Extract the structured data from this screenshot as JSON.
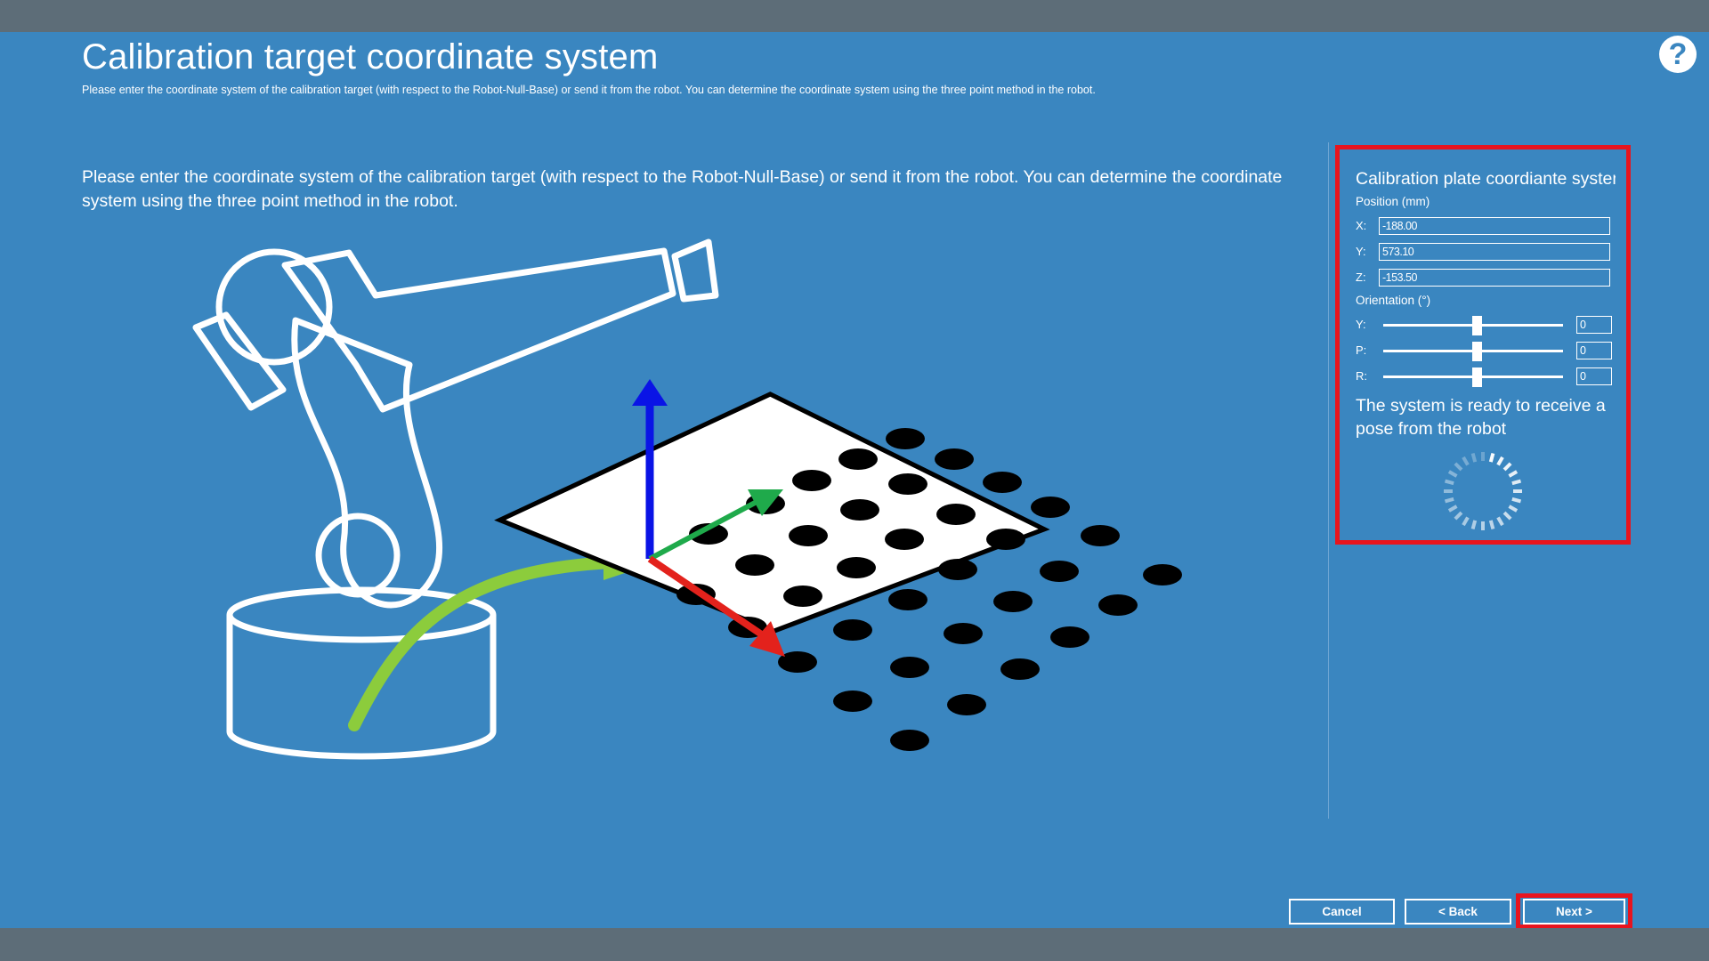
{
  "header": {
    "title": "Calibration target coordinate system",
    "subtitle": "Please enter the coordinate system of the calibration target (with respect to the Robot-Null-Base) or send it from the robot. You can determine the coordinate system using the three point method in the robot.",
    "help_glyph": "?"
  },
  "main": {
    "instructions": "Please enter the coordinate system of the calibration target (with respect to the Robot-Null-Base) or send it from the robot. You can determine the coordinate system using the three point method in the robot."
  },
  "panel": {
    "title": "Calibration plate coordiante system",
    "position_label": "Position (mm)",
    "position": [
      {
        "label": "X:",
        "value": "-188.00"
      },
      {
        "label": "Y:",
        "value": "573.10"
      },
      {
        "label": "Z:",
        "value": "-153.50"
      }
    ],
    "orientation_label": "Orientation (°)",
    "orientation": [
      {
        "label": "Y:",
        "value": "0",
        "slider_fraction": 0.5
      },
      {
        "label": "P:",
        "value": "0",
        "slider_fraction": 0.5
      },
      {
        "label": "R:",
        "value": "0",
        "slider_fraction": 0.5
      }
    ],
    "status": "The system is ready to receive a pose from the robot"
  },
  "footer": {
    "cancel_label": "Cancel",
    "back_label": "< Back",
    "next_label": "Next >"
  },
  "colors": {
    "background": "#3a86c0",
    "bar": "#5d6d78",
    "highlight": "#e8141e",
    "axis_x": "#e3221c",
    "axis_y": "#1faa4b",
    "axis_z": "#0a14e6",
    "path": "#8ccc3c"
  },
  "icons": [
    "help-icon",
    "robot-arm-illustration",
    "calibration-plate-illustration",
    "loading-spinner-icon"
  ]
}
